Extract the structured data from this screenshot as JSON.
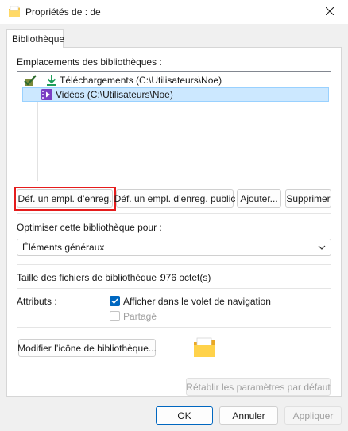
{
  "window": {
    "title": "Propriétés de : de",
    "icon": "library-folder-icon"
  },
  "tabs": [
    {
      "label": "Bibliothèque",
      "active": true
    }
  ],
  "locations": {
    "label": "Emplacements des bibliothèques :",
    "items": [
      {
        "label": "Téléchargements (C:\\Utilisateurs\\Noe)",
        "icon": "download-arrow-icon",
        "selected": false,
        "default_marker": "save-location-check-icon"
      },
      {
        "label": "Vidéos (C:\\Utilisateurs\\Noe)",
        "icon": "video-folder-icon",
        "selected": true
      }
    ]
  },
  "location_buttons": {
    "set_save": "Déf. un empl. d’enreg.",
    "set_public_save": "Déf. un empl. d’enreg. public",
    "add": "Ajouter...",
    "remove": "Supprimer"
  },
  "optimize": {
    "label": "Optimiser cette bibliothèque pour :",
    "selected": "Éléments généraux"
  },
  "size": {
    "label": "Taille des fichiers de bibliothèque :",
    "value": "976 octet(s)"
  },
  "attributes": {
    "label": "Attributs :",
    "show_in_nav": {
      "label": "Afficher dans le volet de navigation",
      "checked": true
    },
    "shared": {
      "label": "Partagé",
      "checked": false,
      "disabled": true
    }
  },
  "change_icon_label": "Modifier l’icône de bibliothèque...",
  "restore_defaults_label": "Rétablir les paramètres par défaut",
  "dialog_buttons": {
    "ok": "OK",
    "cancel": "Annuler",
    "apply": "Appliquer"
  },
  "colors": {
    "accent": "#0067c0",
    "selection": "#cce8ff",
    "highlight_border": "#e51c1c"
  }
}
